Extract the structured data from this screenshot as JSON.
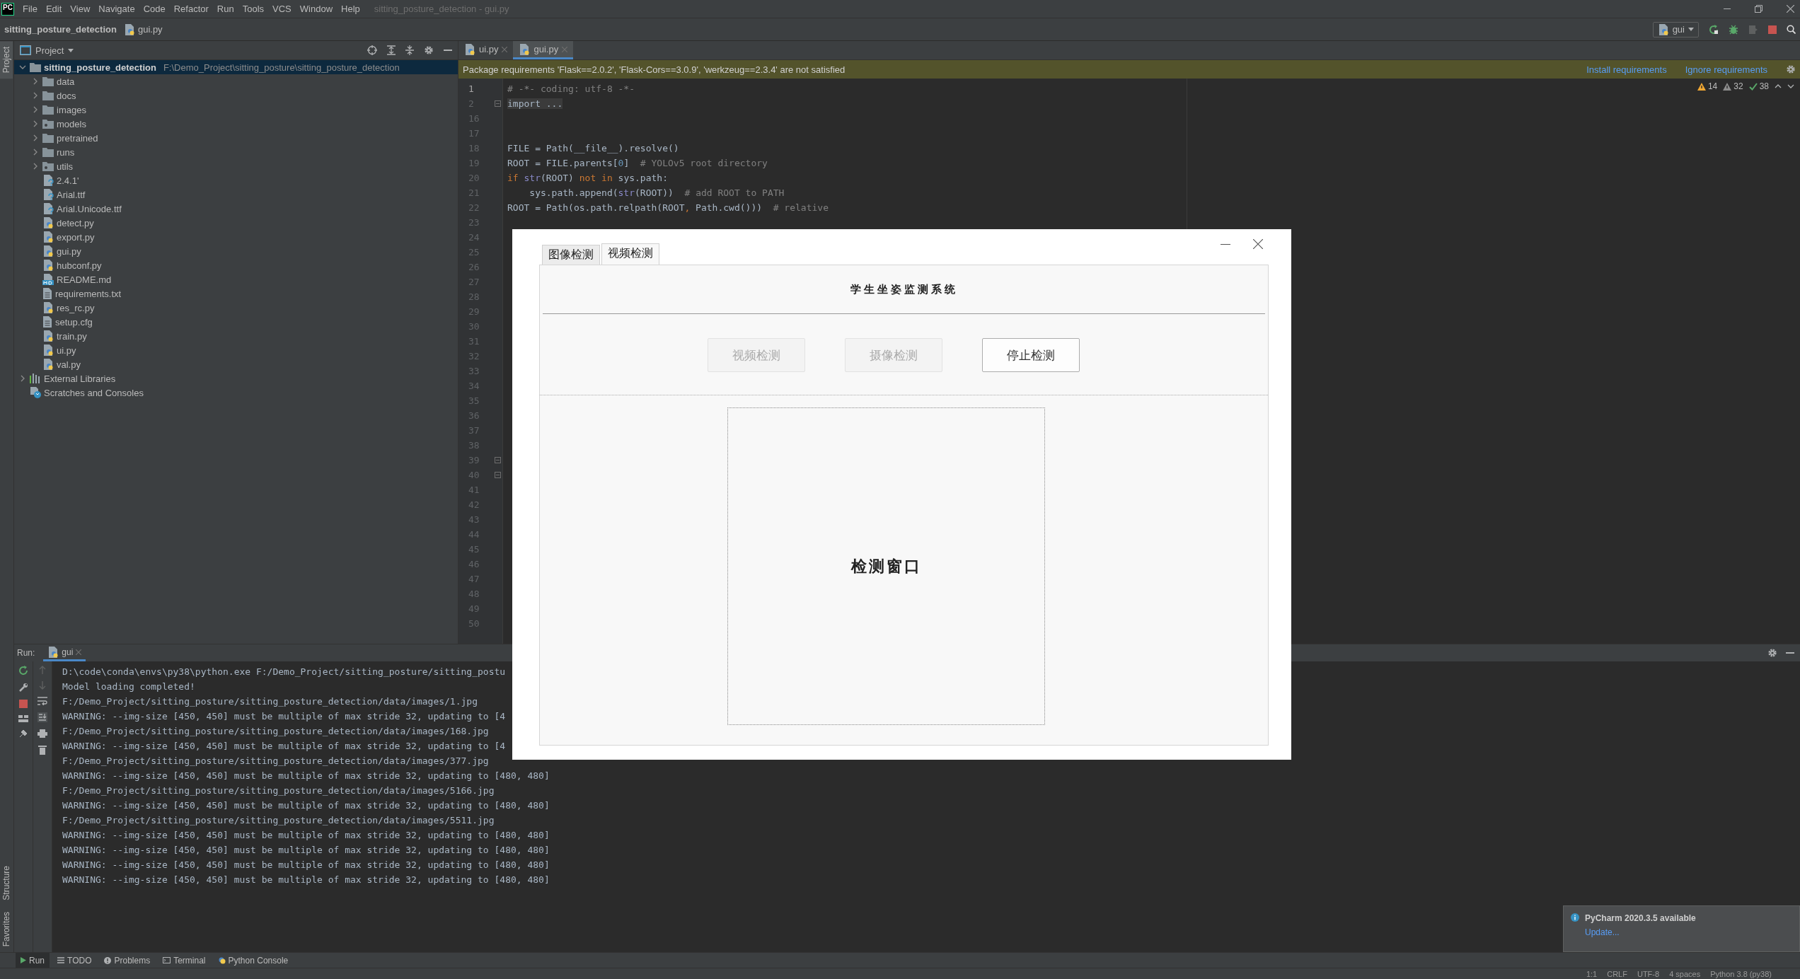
{
  "window": {
    "logo": "PC",
    "title": "sitting_posture_detection - gui.py"
  },
  "menu": [
    "File",
    "Edit",
    "View",
    "Navigate",
    "Code",
    "Refactor",
    "Run",
    "Tools",
    "VCS",
    "Window",
    "Help"
  ],
  "navigation_bar": {
    "project": "sitting_posture_detection",
    "file": "gui.py",
    "run_config": "gui"
  },
  "side_strip": {
    "top": [
      {
        "label": "Project",
        "selected": true
      }
    ],
    "bottom": [
      {
        "label": "Structure",
        "selected": false
      },
      {
        "label": "Favorites",
        "selected": false
      }
    ]
  },
  "project_panel": {
    "title": "Project",
    "tree": [
      {
        "label": "sitting_posture_detection",
        "path": "F:\\Demo_Project\\sitting_posture\\sitting_posture_detection",
        "kind": "folder",
        "expanded": true,
        "selected": true,
        "children": [
          {
            "label": "data",
            "kind": "folder",
            "expanded": false,
            "selected": false
          },
          {
            "label": "docs",
            "kind": "folder",
            "expanded": false,
            "selected": false
          },
          {
            "label": "images",
            "kind": "folder",
            "expanded": false,
            "selected": false
          },
          {
            "label": "models",
            "kind": "package",
            "expanded": false,
            "selected": false
          },
          {
            "label": "pretrained",
            "kind": "folder",
            "expanded": false,
            "selected": false
          },
          {
            "label": "runs",
            "kind": "folder",
            "expanded": false,
            "selected": false
          },
          {
            "label": "utils",
            "kind": "package",
            "expanded": false,
            "selected": false
          },
          {
            "label": "2.4.1'",
            "kind": "unknown",
            "selected": false
          },
          {
            "label": "Arial.ttf",
            "kind": "unknown",
            "selected": false
          },
          {
            "label": "Arial.Unicode.ttf",
            "kind": "unknown",
            "selected": false
          },
          {
            "label": "detect.py",
            "kind": "python",
            "selected": false
          },
          {
            "label": "export.py",
            "kind": "python",
            "selected": false
          },
          {
            "label": "gui.py",
            "kind": "python",
            "selected": false
          },
          {
            "label": "hubconf.py",
            "kind": "python",
            "selected": false
          },
          {
            "label": "README.md",
            "kind": "markdown",
            "selected": false
          },
          {
            "label": "requirements.txt",
            "kind": "text",
            "selected": false
          },
          {
            "label": "res_rc.py",
            "kind": "python",
            "selected": false
          },
          {
            "label": "setup.cfg",
            "kind": "text",
            "selected": false
          },
          {
            "label": "train.py",
            "kind": "python",
            "selected": false
          },
          {
            "label": "ui.py",
            "kind": "python",
            "selected": false
          },
          {
            "label": "val.py",
            "kind": "python",
            "selected": false
          }
        ]
      },
      {
        "label": "External Libraries",
        "kind": "library",
        "expanded": false,
        "selected": false
      },
      {
        "label": "Scratches and Consoles",
        "kind": "scratches",
        "selected": false
      }
    ]
  },
  "editor": {
    "tabs": [
      {
        "label": "ui.py",
        "selected": false
      },
      {
        "label": "gui.py",
        "selected": true
      }
    ],
    "banner": {
      "message": "Package requirements 'Flask==2.0.2', 'Flask-Cors==3.0.9', 'werkzeug==2.3.4' are not satisfied",
      "actions": [
        "Install requirements",
        "Ignore requirements"
      ]
    },
    "inspections": [
      {
        "kind": "warning",
        "count": "14"
      },
      {
        "kind": "weak_warning",
        "count": "32"
      },
      {
        "kind": "typo",
        "count": "38"
      }
    ],
    "lines": [
      {
        "number": "1",
        "current": true,
        "tokens": [
          {
            "kind": "comment",
            "text": "# -*- coding: utf-8 -*-"
          }
        ]
      },
      {
        "number": "2",
        "current": false,
        "fold": true,
        "tokens": [
          {
            "kind": "folded",
            "text": "import ..."
          }
        ]
      },
      {
        "number": "16",
        "current": false
      },
      {
        "number": "17",
        "current": false
      },
      {
        "number": "18",
        "current": false,
        "tokens": [
          {
            "kind": "text",
            "text": "FILE = Path(__file__).resolve()"
          }
        ]
      },
      {
        "number": "19",
        "current": false,
        "tokens": [
          {
            "kind": "text",
            "text": "ROOT = FILE.parents["
          },
          {
            "kind": "number",
            "text": "0"
          },
          {
            "kind": "text",
            "text": "]  "
          },
          {
            "kind": "comment",
            "text": "# YOLOv5 root directory"
          }
        ]
      },
      {
        "number": "20",
        "current": false,
        "tokens": [
          {
            "kind": "keyword",
            "text": "if "
          },
          {
            "kind": "builtin",
            "text": "str"
          },
          {
            "kind": "text",
            "text": "(ROOT) "
          },
          {
            "kind": "keyword",
            "text": "not in "
          },
          {
            "kind": "text",
            "text": "sys.path:"
          }
        ]
      },
      {
        "number": "21",
        "current": false,
        "tokens": [
          {
            "kind": "text",
            "text": "    sys.path.append("
          },
          {
            "kind": "builtin",
            "text": "str"
          },
          {
            "kind": "text",
            "text": "(ROOT))  "
          },
          {
            "kind": "comment",
            "text": "# add ROOT to PATH"
          }
        ]
      },
      {
        "number": "22",
        "current": false,
        "tokens": [
          {
            "kind": "text",
            "text": "ROOT = Path(os.path.relpath(ROOT"
          },
          {
            "kind": "keyword",
            "text": ", "
          },
          {
            "kind": "text",
            "text": "Path.cwd()))  "
          },
          {
            "kind": "comment",
            "text": "# relative"
          }
        ]
      },
      {
        "number": "23",
        "current": false
      },
      {
        "number": "24",
        "current": false
      },
      {
        "number": "25",
        "current": false
      },
      {
        "number": "26",
        "current": false
      },
      {
        "number": "27",
        "current": false
      },
      {
        "number": "28",
        "current": false
      },
      {
        "number": "29",
        "current": false
      },
      {
        "number": "30",
        "current": false
      },
      {
        "number": "31",
        "current": false
      },
      {
        "number": "32",
        "current": false
      },
      {
        "number": "33",
        "current": false
      },
      {
        "number": "34",
        "current": false
      },
      {
        "number": "35",
        "current": false
      },
      {
        "number": "36",
        "current": false
      },
      {
        "number": "37",
        "current": false
      },
      {
        "number": "38",
        "current": false
      },
      {
        "number": "39",
        "current": false,
        "fold": true
      },
      {
        "number": "40",
        "current": false,
        "fold": true
      },
      {
        "number": "41",
        "current": false
      },
      {
        "number": "42",
        "current": false
      },
      {
        "number": "43",
        "current": false
      },
      {
        "number": "44",
        "current": false
      },
      {
        "number": "45",
        "current": false
      },
      {
        "number": "46",
        "current": false
      },
      {
        "number": "47",
        "current": false
      },
      {
        "number": "48",
        "current": false
      },
      {
        "number": "49",
        "current": false
      },
      {
        "number": "50",
        "current": false
      }
    ]
  },
  "run_panel": {
    "label": "Run:",
    "tab": "gui",
    "output": [
      "D:\\code\\conda\\envs\\py38\\python.exe F:/Demo_Project/sitting_posture/sitting_postu",
      "Model loading completed!",
      "F:/Demo_Project/sitting_posture/sitting_posture_detection/data/images/1.jpg",
      "WARNING: --img-size [450, 450] must be multiple of max stride 32, updating to [4",
      "F:/Demo_Project/sitting_posture/sitting_posture_detection/data/images/168.jpg",
      "WARNING: --img-size [450, 450] must be multiple of max stride 32, updating to [4",
      "F:/Demo_Project/sitting_posture/sitting_posture_detection/data/images/377.jpg",
      "WARNING: --img-size [450, 450] must be multiple of max stride 32, updating to [480, 480]",
      "F:/Demo_Project/sitting_posture/sitting_posture_detection/data/images/5166.jpg",
      "WARNING: --img-size [450, 450] must be multiple of max stride 32, updating to [480, 480]",
      "F:/Demo_Project/sitting_posture/sitting_posture_detection/data/images/5511.jpg",
      "WARNING: --img-size [450, 450] must be multiple of max stride 32, updating to [480, 480]",
      "WARNING: --img-size [450, 450] must be multiple of max stride 32, updating to [480, 480]",
      "WARNING: --img-size [450, 450] must be multiple of max stride 32, updating to [480, 480]",
      "WARNING: --img-size [450, 450] must be multiple of max stride 32, updating to [480, 480]"
    ]
  },
  "tool_windows": [
    {
      "label": "Run",
      "kind": "run",
      "selected": true
    },
    {
      "label": "TODO",
      "kind": "todo",
      "selected": false
    },
    {
      "label": "Problems",
      "kind": "problems",
      "selected": false
    },
    {
      "label": "Terminal",
      "kind": "terminal",
      "selected": false
    },
    {
      "label": "Python Console",
      "kind": "python",
      "selected": false
    }
  ],
  "status_bar": [
    "1:1",
    "CRLF",
    "UTF-8",
    "4 spaces",
    "Python 3.8 (py38)"
  ],
  "notification": {
    "title": "PyCharm 2020.3.5 available",
    "link": "Update..."
  },
  "dialog": {
    "tabs": [
      {
        "label": "图像检测",
        "selected": false
      },
      {
        "label": "视频检测",
        "selected": true
      }
    ],
    "title": "学生坐姿监测系统",
    "buttons": [
      {
        "label": "视频检测",
        "disabled": true
      },
      {
        "label": "摄像检测",
        "disabled": true
      },
      {
        "label": "停止检测",
        "disabled": false
      }
    ],
    "display": "检测窗口"
  }
}
